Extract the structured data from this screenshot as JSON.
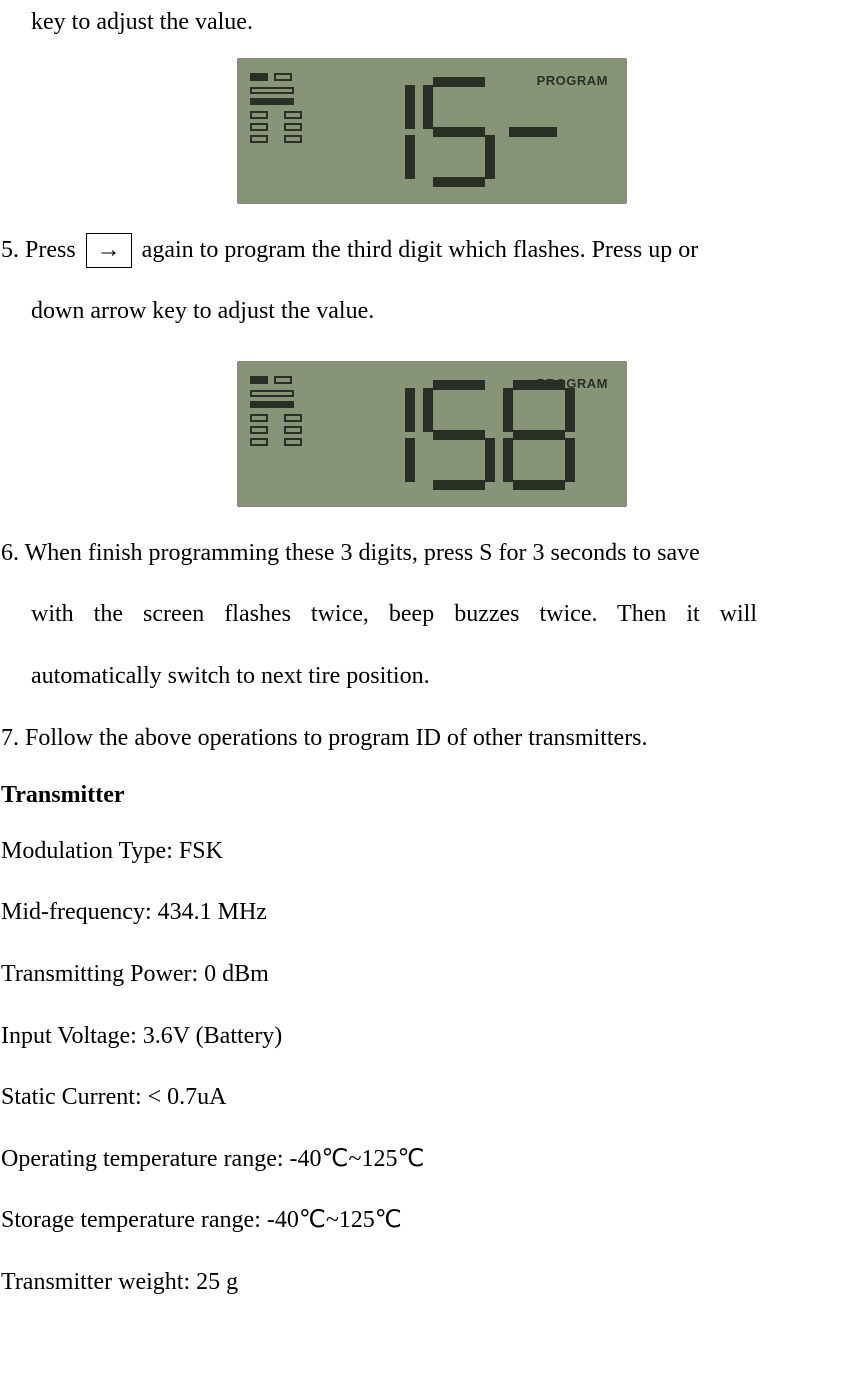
{
  "frag_top": "key to adjust the value.",
  "arrow_label": "→",
  "displays": [
    {
      "digits": "15-",
      "program_label": "PROGRAM"
    },
    {
      "digits": "158",
      "program_label": "PROGRAM"
    }
  ],
  "step5": {
    "pre": "5. Press",
    "post": "again to program the third digit which flashes. Press up or",
    "line2": "down arrow key to adjust the value."
  },
  "step6": {
    "first": "6. When finish programming these 3 digits, press S for 3 seconds to save",
    "line2": "with  the  screen  flashes  twice,  beep  buzzes  twice.  Then  it  will",
    "line3": "automatically switch to next tire position."
  },
  "step7": "7. Follow the above operations to program ID of other transmitters.",
  "transmitter_title": "Transmitter",
  "specs": [
    "Modulation Type: FSK",
    "Mid-frequency: 434.1 MHz",
    "Transmitting Power: 0 dBm",
    "Input Voltage: 3.6V (Battery)",
    "Static Current: < 0.7uA",
    "Operating temperature range: -40℃~125℃",
    "Storage temperature range: -40℃~125℃",
    "Transmitter weight: 25 g"
  ]
}
